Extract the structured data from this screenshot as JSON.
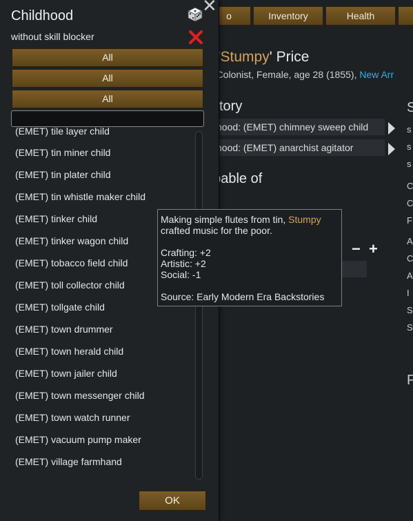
{
  "background": {
    "tabs": [
      {
        "label": "o"
      },
      {
        "label": "Inventory"
      },
      {
        "label": "Health"
      }
    ],
    "title_prefix": "o '",
    "pawn_name": "Stumpy",
    "title_suffix": "' Price",
    "subtitle_text": "n, Colonist, Female, age 28 (1855), ",
    "subtitle_link": "New Arr",
    "section_backstory": "kstory",
    "backstory_rows": [
      "hood: (EMET) chimney sweep child",
      "hood: (EMET) anarchist agitator"
    ],
    "section_capable": "apable of",
    "right_fragments": [
      "S",
      "s",
      "s",
      "s",
      "C",
      "C",
      "F",
      "A",
      "C",
      "A",
      "I",
      "S",
      "S"
    ],
    "minus": "−",
    "plus": "+",
    "bottom_fragment": "P"
  },
  "dialog": {
    "title": "Childhood",
    "filter_label": "without skill blocker",
    "category_buttons": [
      "All",
      "All",
      "All"
    ],
    "search": {
      "value": "",
      "placeholder": ""
    },
    "items": [
      "(EMET) tile layer child",
      "(EMET) tin miner child",
      "(EMET) tin plater child",
      "(EMET) tin whistle maker child",
      "(EMET) tinker child",
      "(EMET) tinker wagon child",
      "(EMET) tobacco field child",
      "(EMET) toll collector child",
      "(EMET) tollgate child",
      "(EMET) town drummer",
      "(EMET) town herald child",
      "(EMET) town jailer child",
      "(EMET) town messenger child",
      "(EMET) town watch runner",
      "(EMET) vacuum pump maker",
      "(EMET) village farmhand"
    ],
    "ok_label": "OK",
    "close_glyph": "✕"
  },
  "tooltip": {
    "desc_before": "Making simple flutes from tin, ",
    "desc_name": "Stumpy",
    "desc_after": " crafted music for the poor.",
    "skills": [
      "Crafting: +2",
      "Artistic: +2",
      "Social: -1"
    ],
    "source": "Source: Early Modern Era Backstories"
  },
  "colors": {
    "accent_gold": "#d6a35a",
    "link_blue": "#2bb3e8",
    "button_brown": "#6c4e20",
    "danger_red": "#e02020"
  },
  "icons": [
    "dice-icon",
    "red-x-icon",
    "close-icon",
    "arrow-right-icon"
  ]
}
